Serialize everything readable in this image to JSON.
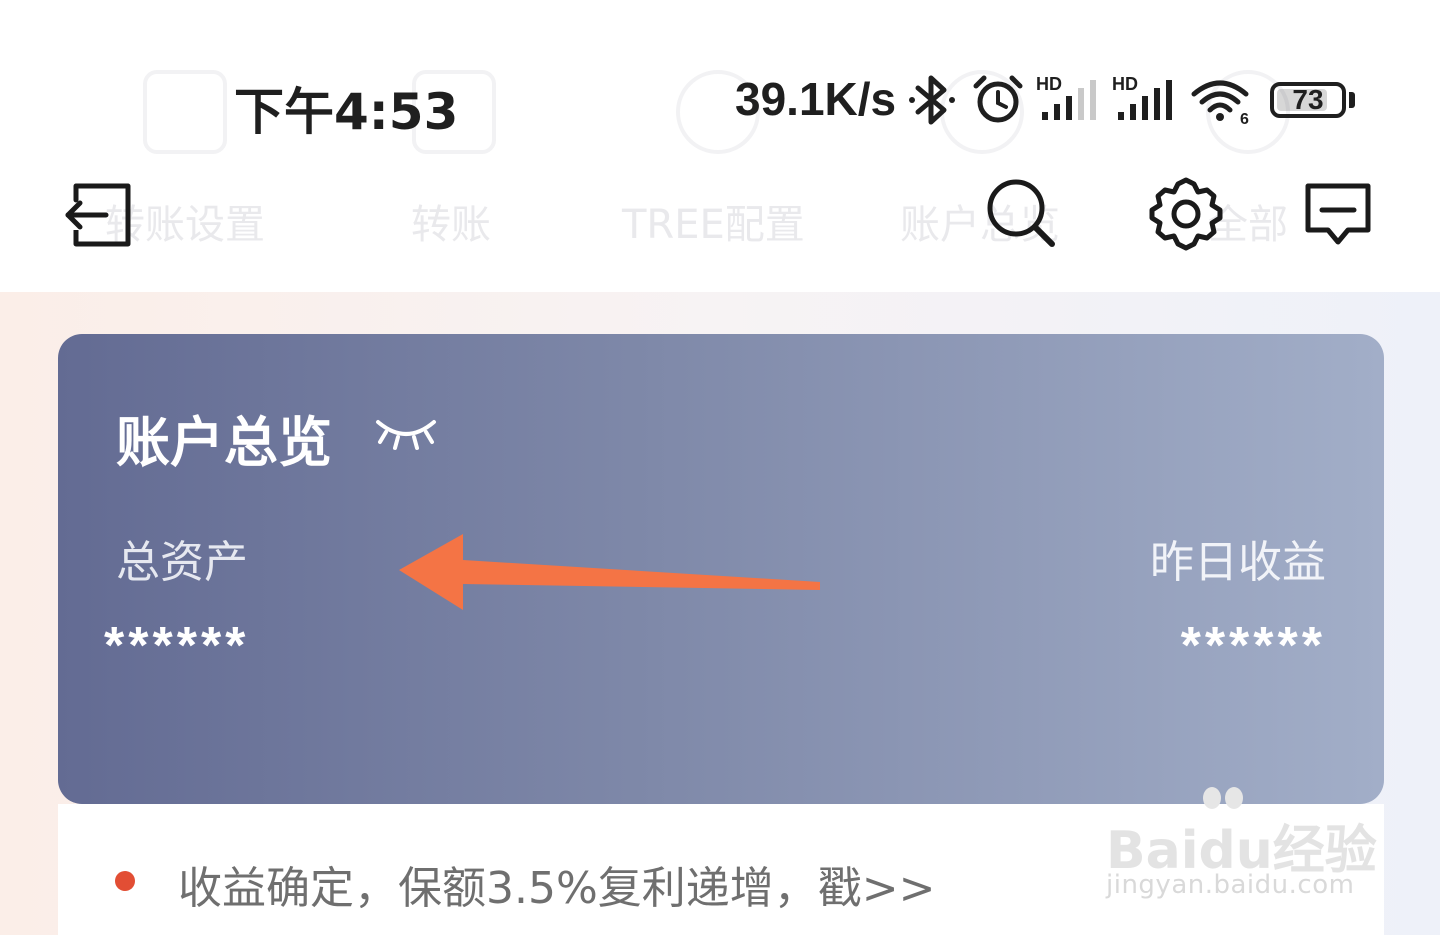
{
  "status_bar": {
    "time": "下午4:53",
    "network_speed": "39.1K/s",
    "battery": "73",
    "icons": [
      "bluetooth-icon",
      "alarm-icon",
      "hd-signal-icon",
      "hd-signal-icon",
      "wifi-icon",
      "battery-icon"
    ]
  },
  "background_tabs": [
    "转账设置",
    "转账",
    "TREE配置",
    "账户总览",
    "全部"
  ],
  "toolbar": {
    "icons": [
      "logout-icon",
      "search-icon",
      "settings-icon",
      "message-icon"
    ]
  },
  "account_card": {
    "title": "账户总览",
    "visibility_icon": "eye-closed-icon",
    "total_assets_label": "总资产",
    "total_assets_value": "******",
    "yesterday_income_label": "昨日收益",
    "yesterday_income_value": "******"
  },
  "promo": {
    "text": "收益确定，保额3.5%复利递增，戳>>"
  },
  "watermark": {
    "logo": "Baidu经验",
    "url": "jingyan.baidu.com"
  },
  "colors": {
    "card_start": "#636b93",
    "card_end": "#a2aec8",
    "arrow": "#f47445",
    "promo_dot": "#e24e34"
  }
}
